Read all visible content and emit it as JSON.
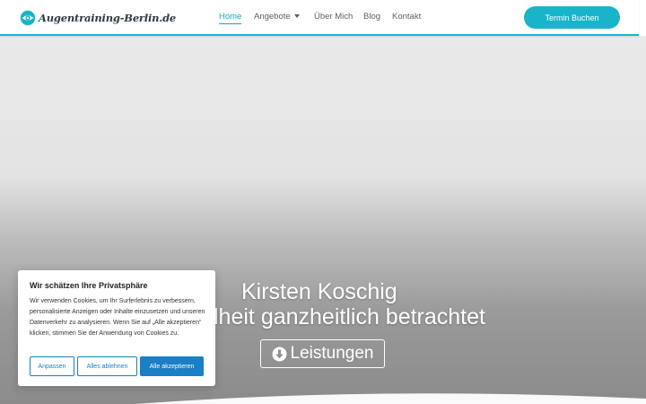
{
  "header": {
    "logo_text": "Augentraining-Berlin.de",
    "nav": {
      "home": "Home",
      "angebote": "Angebote",
      "uber_mich": "Über Mich",
      "blog": "Blog",
      "kontakt": "Kontakt"
    },
    "cta_label": "Termin Buchen"
  },
  "hero": {
    "name": "Kirsten Koschig",
    "subtitle": "Gesundheit ganzheitlich betrachtet",
    "button_label": "Leistungen"
  },
  "cookie_banner": {
    "title": "Wir schätzen Ihre Privatsphäre",
    "text": "Wir verwenden Cookies, um Ihr Surferlebnis zu verbessern, personalisierte Anzeigen oder Inhalte einzusetzen und unseren Datenverkehr zu analysieren. Wenn Sie auf „Alle akzeptieren“ klicken, stimmen Sie der Anwendung von Cookies zu.",
    "buttons": {
      "customize": "Anpassen",
      "reject_all": "Alles ablehnen",
      "accept_all": "Alle akzeptieren"
    }
  },
  "icons": {
    "logo": "eye-icon",
    "nav_dropdown": "caret-down-icon",
    "hero_button": "download-circle-icon"
  },
  "colors": {
    "accent": "#19b4c9",
    "cookie_button": "#1a7fc4",
    "nav_text": "#5a5f63"
  }
}
